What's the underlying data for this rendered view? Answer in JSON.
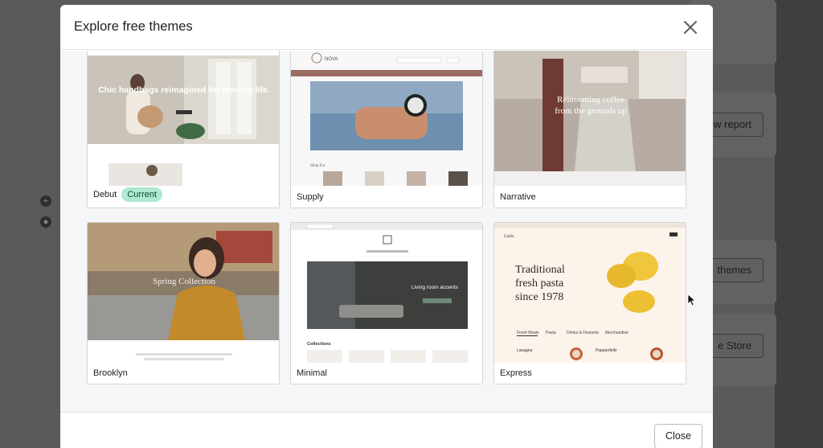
{
  "modal": {
    "title": "Explore free themes",
    "close_button_label": "Close"
  },
  "themes": [
    {
      "name": "Debut",
      "badge": "Current",
      "preview_headline": "Chic handbags reimagined for modern life."
    },
    {
      "name": "Supply",
      "preview_brand": "NOVA",
      "preview_section": "Shop For"
    },
    {
      "name": "Narrative",
      "preview_headline": "Reinventing coffee from the grounds up"
    },
    {
      "name": "Brooklyn",
      "preview_headline": "Spring Collection"
    },
    {
      "name": "Minimal",
      "preview_headline": "Living room accents",
      "preview_section": "Collections"
    },
    {
      "name": "Express",
      "preview_brand": "Giallo",
      "preview_headline": "Traditional fresh pasta since 1978",
      "preview_tabs": [
        "Fresh Meals",
        "Pasta",
        "Drinks & Desserts",
        "Merchandise"
      ],
      "preview_items": [
        "Lasagna",
        "Pappardelle"
      ]
    }
  ],
  "background": {
    "buttons": [
      "ew report",
      "themes",
      "e Store"
    ]
  },
  "colors": {
    "badge_bg": "#aee9d1",
    "badge_text": "#0c5132",
    "overlay": "#4a4a4a"
  }
}
